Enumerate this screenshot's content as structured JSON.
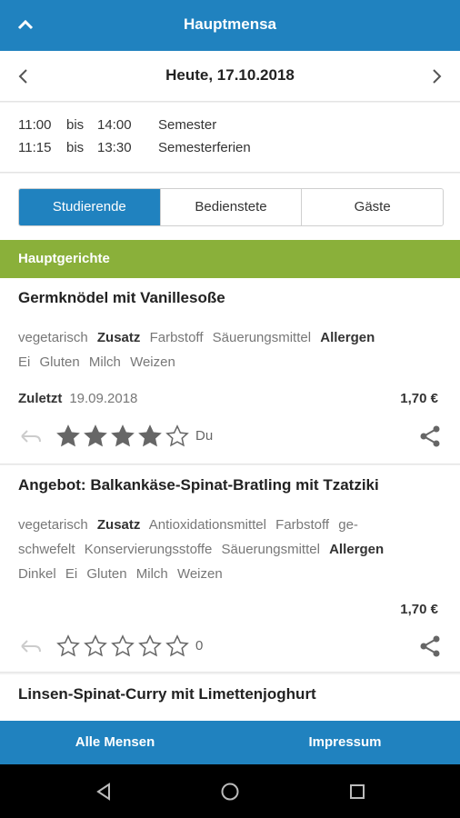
{
  "header": {
    "title": "Hauptmensa"
  },
  "date_nav": {
    "date": "Heute, 17.10.2018"
  },
  "hours": [
    {
      "from": "11:00",
      "sep": "bis",
      "to": "14:00",
      "label": "Semester"
    },
    {
      "from": "11:15",
      "sep": "bis",
      "to": "13:30",
      "label": "Semesterferien"
    }
  ],
  "price_groups": [
    {
      "label": "Studierende",
      "active": true
    },
    {
      "label": "Bedienstete",
      "active": false
    },
    {
      "label": "Gäste",
      "active": false
    }
  ],
  "section": {
    "title": "Hauptgerichte"
  },
  "meals": [
    {
      "name": "Germknödel mit Vanillesoße",
      "tag_line1": {
        "type": "vegetarisch",
        "zusatz_label": "Zusatz",
        "z1": "Farbstoff",
        "z2": "Säuerungsmittel",
        "allergen_label": "Allergen"
      },
      "allergens": [
        "Ei",
        "Gluten",
        "Milch",
        "Weizen"
      ],
      "last_label": "Zuletzt",
      "last_date": "19.09.2018",
      "price": "1,70 €",
      "rating": 4,
      "rating_label": "Du"
    },
    {
      "name": "Angebot: Balkankäse-Spinat-Bratling mit Tzatziki",
      "tag_line1": {
        "type": "vegetarisch",
        "zusatz_label": "Zusatz",
        "z1": "Antioxidationsmittel",
        "z2": "Farbstoff",
        "z3": "ge-"
      },
      "tag_line2": {
        "z1": "schwefelt",
        "z2": "Konservierungsstoffe",
        "z3": "Säuerungsmittel",
        "allergen_label": "Allergen"
      },
      "allergens": [
        "Dinkel",
        "Ei",
        "Gluten",
        "Milch",
        "Weizen"
      ],
      "price": "1,70 €",
      "rating": 0,
      "rating_label": "0"
    },
    {
      "name": "Linsen-Spinat-Curry mit Limettenjoghurt"
    }
  ],
  "bottom_nav": {
    "left": "Alle Mensen",
    "right": "Impressum"
  },
  "colors": {
    "primary": "#2082bf",
    "section": "#8ab03a",
    "star": "#666666"
  },
  "icons": [
    "chevron-up-icon",
    "chevron-left-icon",
    "chevron-right-icon",
    "undo-icon",
    "star-icon",
    "share-icon",
    "back-triangle-icon",
    "home-circle-icon",
    "recents-square-icon"
  ]
}
